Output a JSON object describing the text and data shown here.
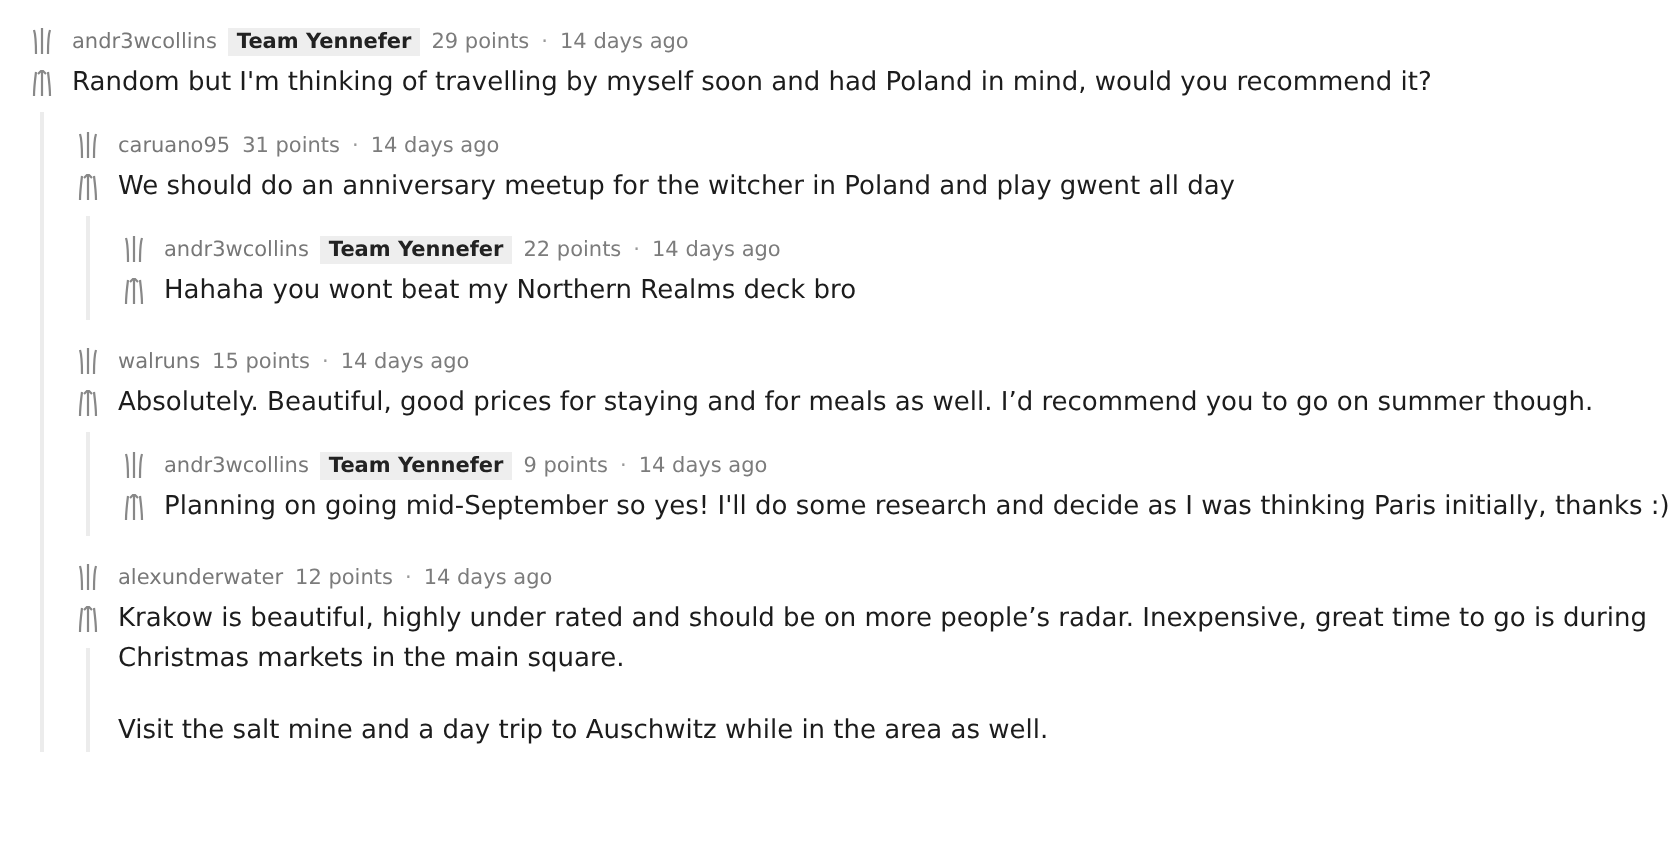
{
  "comments": [
    {
      "author": "andr3wcollins",
      "flair": "Team Yennefer",
      "points": "29 points",
      "separator": "·",
      "time": "14 days ago",
      "body": [
        "Random but I'm thinking of travelling by myself soon and had Poland in mind, would you recommend it?"
      ],
      "children": [
        {
          "author": "caruano95",
          "points": "31 points",
          "separator": "·",
          "time": "14 days ago",
          "body": [
            "We should do an anniversary meetup for the witcher in Poland and play gwent all day"
          ],
          "children": [
            {
              "author": "andr3wcollins",
              "flair": "Team Yennefer",
              "points": "22 points",
              "separator": "·",
              "time": "14 days ago",
              "body": [
                "Hahaha you wont beat my Northern Realms deck bro"
              ]
            }
          ]
        },
        {
          "author": "walruns",
          "points": "15 points",
          "separator": "·",
          "time": "14 days ago",
          "body": [
            "Absolutely. Beautiful, good prices for staying and for meals as well. I’d recommend you to go on summer though."
          ],
          "children": [
            {
              "author": "andr3wcollins",
              "flair": "Team Yennefer",
              "points": "9 points",
              "separator": "·",
              "time": "14 days ago",
              "body": [
                "Planning on going mid-September so yes! I'll do some research and decide as I was thinking Paris initially, thanks :)"
              ]
            }
          ]
        },
        {
          "author": "alexunderwater",
          "points": "12 points",
          "separator": "·",
          "time": "14 days ago",
          "body": [
            "Krakow is beautiful, highly under rated and should be on more people’s radar. Inexpensive, great time to go is during Christmas markets in the main square.",
            "Visit the salt mine and a day trip to Auschwitz while in the area as well."
          ]
        }
      ]
    }
  ]
}
